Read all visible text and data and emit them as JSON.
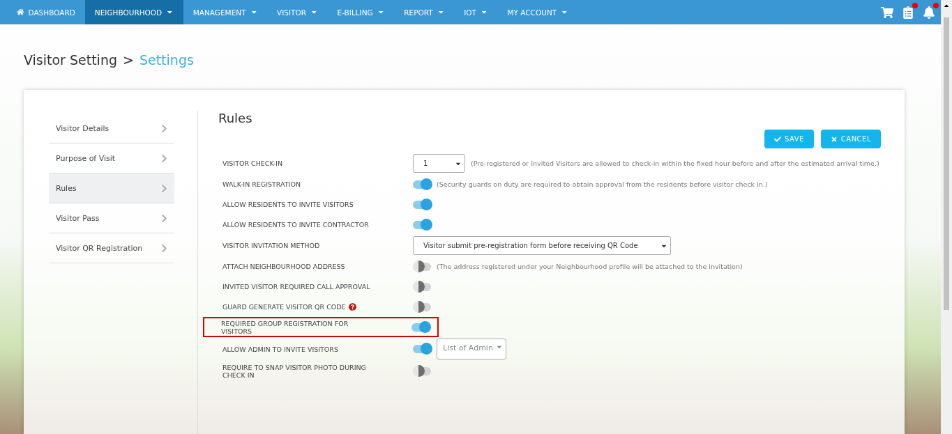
{
  "nav": {
    "items": [
      {
        "kind": "home",
        "label": "DASHBOARD",
        "selected": false
      },
      {
        "kind": "menu",
        "label": "NEIGHBOURHOOD",
        "selected": true
      },
      {
        "kind": "menu",
        "label": "MANAGEMENT",
        "selected": false
      },
      {
        "kind": "menu",
        "label": "VISITOR",
        "selected": false
      },
      {
        "kind": "menu",
        "label": "E-BILLING",
        "selected": false
      },
      {
        "kind": "menu",
        "label": "REPORT",
        "selected": false
      },
      {
        "kind": "menu",
        "label": "IOT",
        "selected": false
      },
      {
        "kind": "menu",
        "label": "MY ACCOUNT",
        "selected": false
      }
    ],
    "icons": [
      {
        "kind": "cart",
        "badge": false
      },
      {
        "kind": "list",
        "badge": true
      },
      {
        "kind": "bell",
        "badge": true
      }
    ]
  },
  "breadcrumb": {
    "parent": "Visitor Setting",
    "separator": ">",
    "current": "Settings"
  },
  "sidebar": {
    "items": [
      {
        "label": "Visitor Details",
        "selected": false
      },
      {
        "label": "Purpose of Visit",
        "selected": false
      },
      {
        "label": "Rules",
        "selected": true
      },
      {
        "label": "Visitor Pass",
        "selected": false
      },
      {
        "label": "Visitor QR Registration",
        "selected": false
      }
    ]
  },
  "panel": {
    "title": "Rules",
    "buttons": [
      {
        "kind": "save",
        "label": "SAVE"
      },
      {
        "kind": "cancel",
        "label": "CANCEL"
      }
    ],
    "rules": [
      {
        "kind": "select",
        "label": "VISITOR CHECK-IN",
        "value": "1",
        "note": "(Pre-registered or Invited Visitors are allowed to check-in within the fixed hour before and after the estimated arrival time.)",
        "highlighted": false
      },
      {
        "kind": "toggle",
        "label": "WALK-IN REGISTRATION",
        "on": true,
        "note": "(Security guards on duty are required to obtain approval from the residents before visitor check in.)",
        "highlighted": false
      },
      {
        "kind": "toggle",
        "label": "ALLOW RESIDENTS TO INVITE VISITORS",
        "on": true,
        "highlighted": false
      },
      {
        "kind": "toggle",
        "label": "ALLOW RESIDENTS TO INVITE CONTRACTOR",
        "on": true,
        "highlighted": false
      },
      {
        "kind": "wide_select",
        "label": "VISITOR INVITATION METHOD",
        "value": "Visitor submit pre-registration form before receiving QR Code",
        "highlighted": false
      },
      {
        "kind": "toggle",
        "label": "ATTACH NEIGHBOURHOOD ADDRESS",
        "on": false,
        "note": "(The address registered under your Neighbourhood profile will be attached to the invitation)",
        "highlighted": false
      },
      {
        "kind": "toggle",
        "label": "INVITED VISITOR REQUIRED CALL APPROVAL",
        "on": false,
        "highlighted": false
      },
      {
        "kind": "toggle",
        "label": "GUARD GENERATE VISITOR QR CODE",
        "on": false,
        "help": true,
        "highlighted": false
      },
      {
        "kind": "toggle",
        "label": "REQUIRED GROUP REGISTRATION FOR VISITORS",
        "on": true,
        "highlighted": true
      },
      {
        "kind": "toggle_select",
        "label": "ALLOW ADMIN TO INVITE VISITORS",
        "on": true,
        "placeholder": "List of Admin",
        "highlighted": false
      },
      {
        "kind": "toggle",
        "label": "REQUIRE TO SNAP VISITOR PHOTO DURING CHECK IN",
        "on": false,
        "highlighted": false
      }
    ]
  }
}
